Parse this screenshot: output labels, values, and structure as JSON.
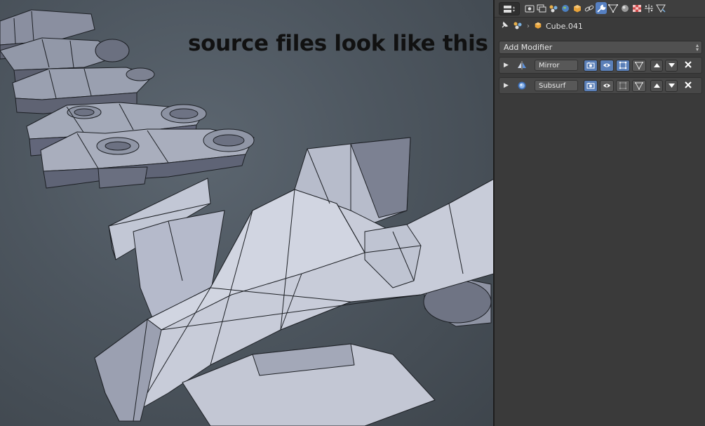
{
  "viewport": {
    "overlay_caption": "source files look like this"
  },
  "properties": {
    "tabs": [
      {
        "icon": "render-icon"
      },
      {
        "icon": "render-layers-icon"
      },
      {
        "icon": "scene-icon"
      },
      {
        "icon": "world-icon"
      },
      {
        "icon": "object-icon"
      },
      {
        "icon": "constraints-icon"
      },
      {
        "icon": "modifiers-icon",
        "active": true
      },
      {
        "icon": "data-icon"
      },
      {
        "icon": "material-icon"
      },
      {
        "icon": "texture-icon"
      },
      {
        "icon": "particles-icon"
      },
      {
        "icon": "physics-icon"
      }
    ],
    "breadcrumb": {
      "object_name": "Cube.041"
    },
    "add_modifier_label": "Add Modifier",
    "modifiers": [
      {
        "name": "Mirror",
        "icon": "mirror-modifier-icon",
        "render": true,
        "viewport": true,
        "editmode": true,
        "cage": false
      },
      {
        "name": "Subsurf",
        "icon": "subsurf-modifier-icon",
        "render": true,
        "viewport": true,
        "editmode": false,
        "cage": false
      }
    ],
    "colors": {
      "accent": "#5680c2",
      "panel_bg": "#3a3a3a",
      "object_icon": "#e8a33a"
    }
  }
}
